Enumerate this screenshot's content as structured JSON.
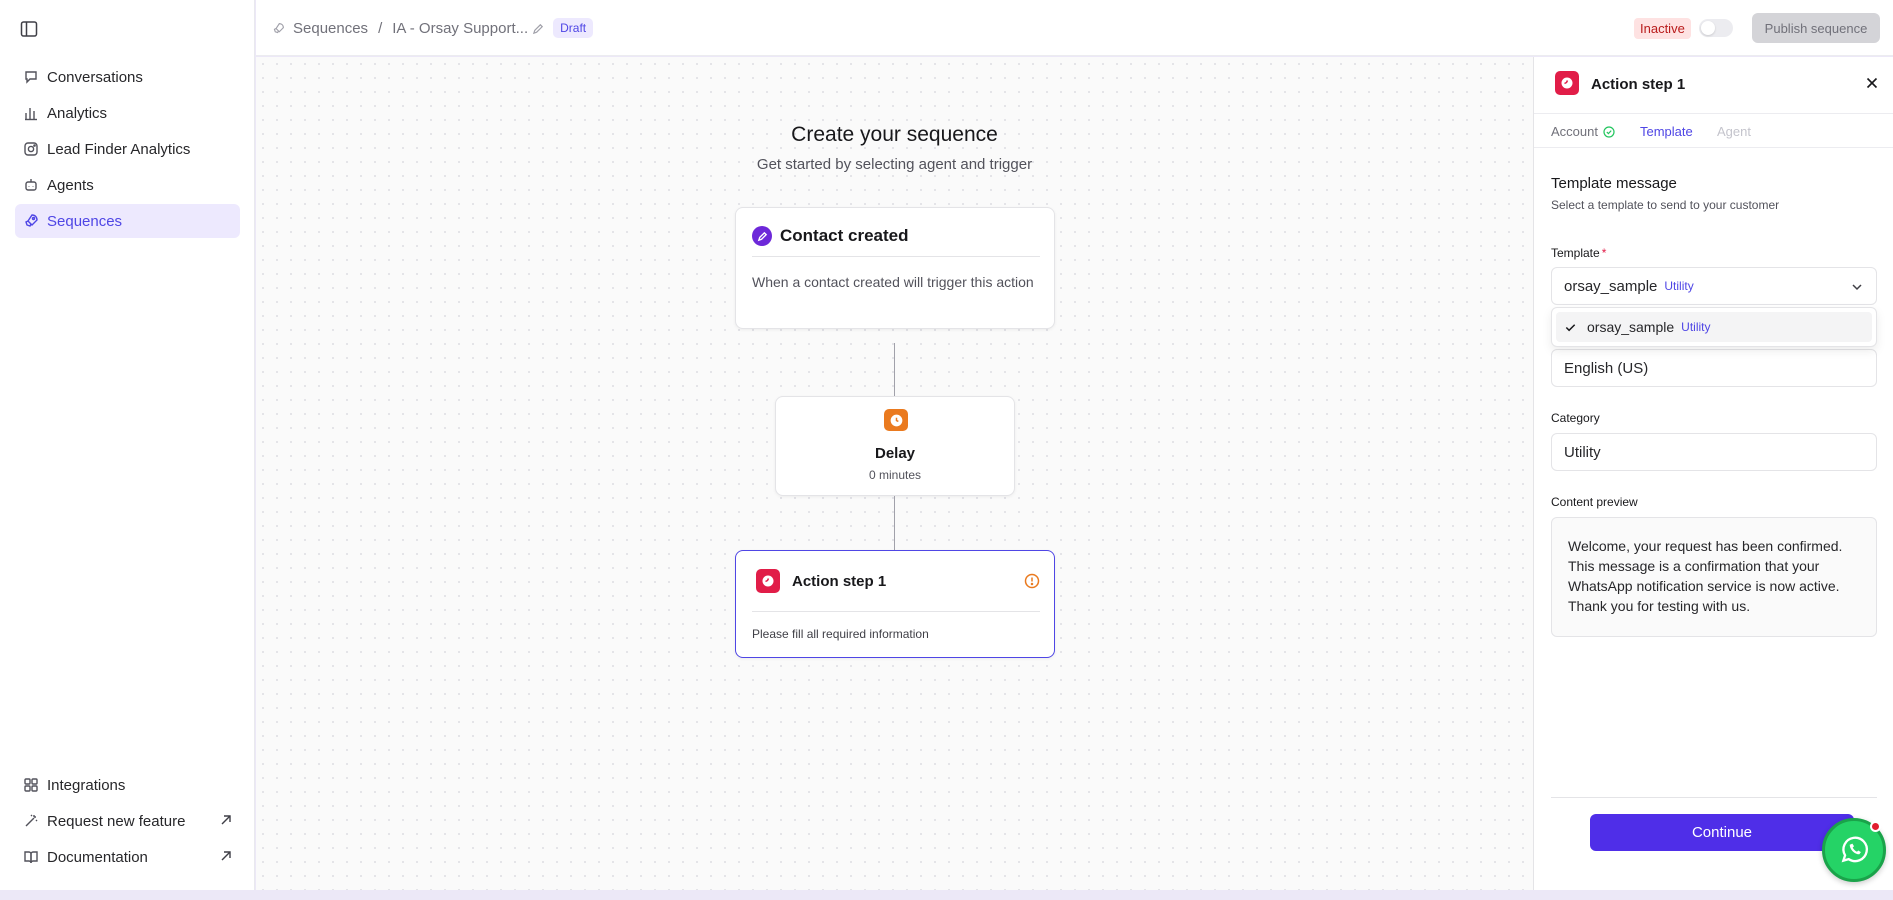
{
  "sidebar": {
    "items": [
      {
        "label": "Conversations",
        "icon": "chat-icon"
      },
      {
        "label": "Analytics",
        "icon": "bar-chart-icon"
      },
      {
        "label": "Lead Finder Analytics",
        "icon": "instagram-icon"
      },
      {
        "label": "Agents",
        "icon": "bot-icon"
      },
      {
        "label": "Sequences",
        "icon": "rocket-icon",
        "active": true
      }
    ],
    "bottom_items": [
      {
        "label": "Integrations",
        "icon": "grid-icon"
      },
      {
        "label": "Request new feature",
        "icon": "magic-wand-icon"
      },
      {
        "label": "Documentation",
        "icon": "book-icon"
      }
    ]
  },
  "header": {
    "breadcrumb_root": "Sequences",
    "breadcrumb_sep": "/",
    "sequence_name": "IA - Orsay Support...",
    "draft_badge": "Draft",
    "status": "Inactive",
    "publish_label": "Publish sequence"
  },
  "canvas": {
    "title": "Create your sequence",
    "subtitle": "Get started by selecting agent and trigger",
    "trigger": {
      "title": "Contact created",
      "description": "When a contact created will trigger this action"
    },
    "delay": {
      "title": "Delay",
      "value": "0 minutes"
    },
    "action": {
      "title": "Action step 1",
      "description": "Please fill all required information"
    }
  },
  "panel": {
    "title": "Action step 1",
    "tabs": {
      "account": "Account",
      "template": "Template",
      "agent": "Agent"
    },
    "section_title": "Template message",
    "section_subtitle": "Select a template to send to your customer",
    "template_label": "Template",
    "required_mark": "*",
    "template_value": "orsay_sample",
    "template_tag": "Utility",
    "dropdown_option": {
      "name": "orsay_sample",
      "tag": "Utility"
    },
    "language_value": "English (US)",
    "category_label": "Category",
    "category_value": "Utility",
    "preview_label": "Content preview",
    "preview_text": "Welcome, your request has been confirmed. This message is a confirmation that your WhatsApp notification service is now active. Thank you for testing with us.",
    "continue_label": "Continue"
  },
  "colors": {
    "accent": "#4f46e5",
    "action_red": "#e11d48",
    "delay_orange": "#ea7a1f",
    "whatsapp_green": "#25d366"
  }
}
